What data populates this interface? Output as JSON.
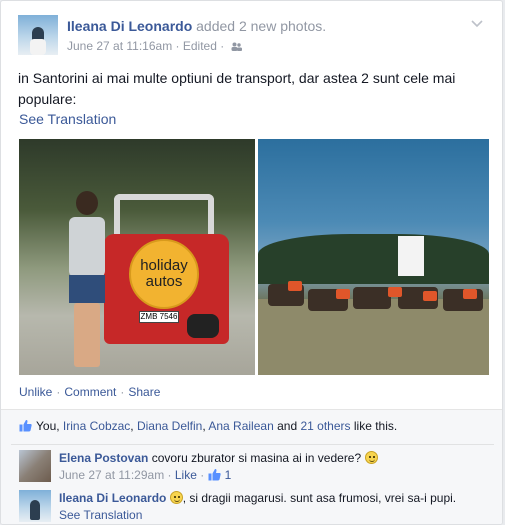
{
  "post": {
    "author": "Ileana Di Leonardo",
    "action": "added 2 new photos.",
    "date": "June 27 at 11:16am",
    "edited": "Edited",
    "audience_icon": "friends-icon",
    "menu_icon": "chevron-down-icon",
    "text": "in Santorini ai mai multe optiuni de transport, dar astea 2 sunt cele mai populare:",
    "see_translation": "See Translation"
  },
  "photos": {
    "photo1": {
      "wheel_line1": "holiday",
      "wheel_line2": "autos",
      "plate": "ZMB 7546"
    }
  },
  "actions": {
    "unlike": "Unlike",
    "comment": "Comment",
    "share": "Share"
  },
  "likes": {
    "you": "You",
    "name1": "Irina Cobzac",
    "name2": "Diana Delfin",
    "name3": "Ana Railean",
    "and": "and",
    "others": "21 others",
    "suffix": "like this."
  },
  "comments": [
    {
      "author": "Elena Postovan",
      "text": "covoru zburator si masina ai in vedere?",
      "time": "June 27 at 11:29am",
      "like": "Like",
      "like_count": "1"
    },
    {
      "author": "Ileana Di Leonardo",
      "text": ", si dragii magarusi. sunt asa frumosi, vrei sa-i pupi.",
      "see_translation": "See Translation"
    }
  ],
  "colors": {
    "link": "#3b5998",
    "muted": "#9197a3",
    "text": "#141823"
  }
}
